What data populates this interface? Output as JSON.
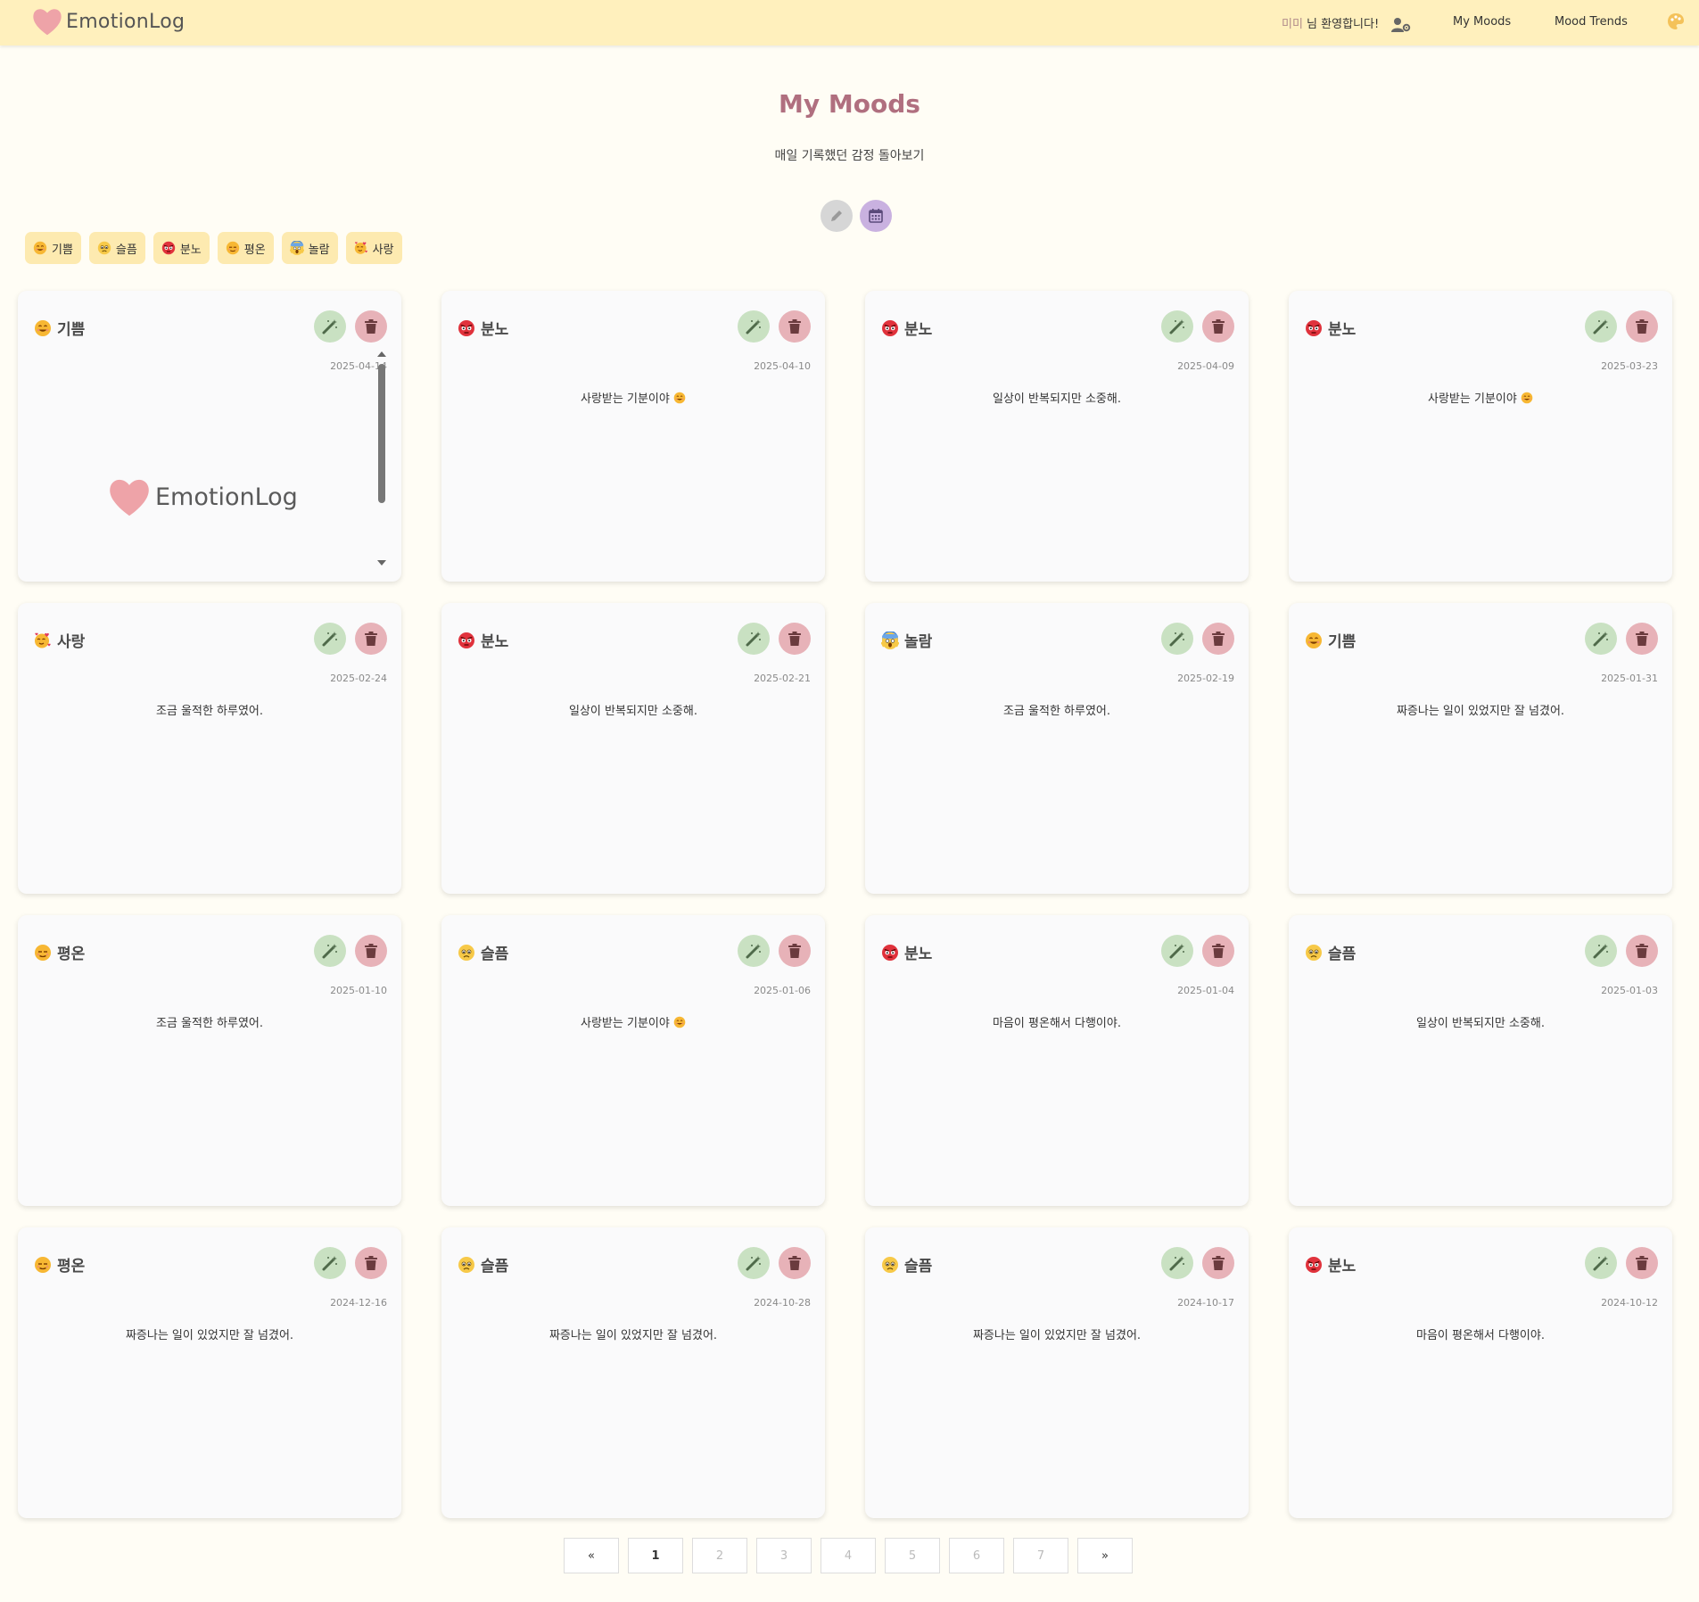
{
  "navbar": {
    "brand": "EmotionLog",
    "nickname": "미미",
    "welcome_suffix": " 님 환영합니다!",
    "links": [
      "My Moods",
      "Mood Trends"
    ]
  },
  "header": {
    "title": "My Moods",
    "subtitle": "매일 기록했던 감정 돌아보기"
  },
  "filters": [
    {
      "icon": "joy-emoji",
      "label": "기쁨"
    },
    {
      "icon": "sad-emoji",
      "label": "슬픔"
    },
    {
      "icon": "angry-emoji",
      "label": "분노"
    },
    {
      "icon": "calm-emoji",
      "label": "평온"
    },
    {
      "icon": "surprise-emoji",
      "label": "놀람"
    },
    {
      "icon": "love-emoji",
      "label": "사랑"
    }
  ],
  "cards": [
    {
      "emotion": "기쁨",
      "icon": "joy-emoji",
      "date": "2025-04-14",
      "text": "",
      "image_text": "EmotionLog"
    },
    {
      "emotion": "분노",
      "icon": "angry-emoji",
      "date": "2025-04-10",
      "text": "사랑받는 기분이야",
      "text_emoji": "joy-emoji"
    },
    {
      "emotion": "분노",
      "icon": "angry-emoji",
      "date": "2025-04-09",
      "text": "일상이 반복되지만 소중해."
    },
    {
      "emotion": "분노",
      "icon": "angry-emoji",
      "date": "2025-03-23",
      "text": "사랑받는 기분이야",
      "text_emoji": "joy-emoji"
    },
    {
      "emotion": "사랑",
      "icon": "love-emoji",
      "date": "2025-02-24",
      "text": "조금 울적한 하루였어."
    },
    {
      "emotion": "분노",
      "icon": "angry-emoji",
      "date": "2025-02-21",
      "text": "일상이 반복되지만 소중해."
    },
    {
      "emotion": "놀람",
      "icon": "surprise-emoji",
      "date": "2025-02-19",
      "text": "조금 울적한 하루였어."
    },
    {
      "emotion": "기쁨",
      "icon": "joy-emoji",
      "date": "2025-01-31",
      "text": "짜증나는 일이 있었지만 잘 넘겼어."
    },
    {
      "emotion": "평온",
      "icon": "calm-emoji",
      "date": "2025-01-10",
      "text": "조금 울적한 하루였어."
    },
    {
      "emotion": "슬픔",
      "icon": "sad-emoji",
      "date": "2025-01-06",
      "text": "사랑받는 기분이야",
      "text_emoji": "joy-emoji"
    },
    {
      "emotion": "분노",
      "icon": "angry-emoji",
      "date": "2025-01-04",
      "text": "마음이 평온해서 다행이야."
    },
    {
      "emotion": "슬픔",
      "icon": "sad-emoji",
      "date": "2025-01-03",
      "text": "일상이 반복되지만 소중해."
    },
    {
      "emotion": "평온",
      "icon": "calm-emoji",
      "date": "2024-12-16",
      "text": "짜증나는 일이 있었지만 잘 넘겼어."
    },
    {
      "emotion": "슬픔",
      "icon": "sad-emoji",
      "date": "2024-10-28",
      "text": "짜증나는 일이 있었지만 잘 넘겼어."
    },
    {
      "emotion": "슬픔",
      "icon": "sad-emoji",
      "date": "2024-10-17",
      "text": "짜증나는 일이 있었지만 잘 넘겼어."
    },
    {
      "emotion": "분노",
      "icon": "angry-emoji",
      "date": "2024-10-12",
      "text": "마음이 평온해서 다행이야."
    }
  ],
  "pagination": {
    "prev": "«",
    "pages": [
      "1",
      "2",
      "3",
      "4",
      "5",
      "6",
      "7"
    ],
    "current": "1",
    "next": "»"
  },
  "colors": {
    "navbar_bg": "#fff0bd",
    "title": "#b06f7f",
    "chip_bg": "#fdeab0",
    "edit_btn": "#c9e1c2",
    "delete_btn": "#e7b2b8",
    "calendar_btn": "#c9b1e0",
    "heart": "#eea3a8"
  }
}
